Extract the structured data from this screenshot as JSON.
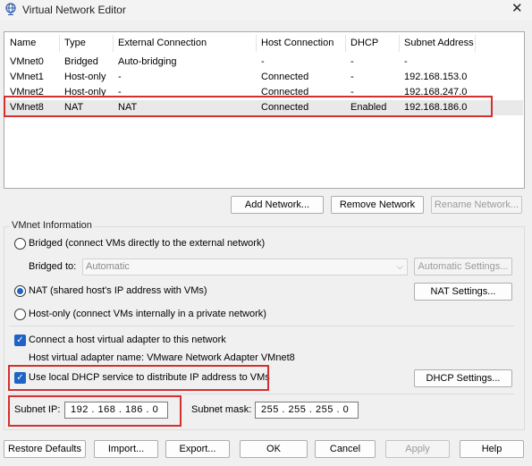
{
  "window": {
    "title": "Virtual Network Editor",
    "close_glyph": "✕",
    "icon": "network-globe-icon"
  },
  "table": {
    "columns": [
      "Name",
      "Type",
      "External Connection",
      "Host Connection",
      "DHCP",
      "Subnet Address"
    ],
    "rows": [
      {
        "name": "VMnet0",
        "type": "Bridged",
        "external": "Auto-bridging",
        "host": "-",
        "dhcp": "-",
        "subnet": "-"
      },
      {
        "name": "VMnet1",
        "type": "Host-only",
        "external": "-",
        "host": "Connected",
        "dhcp": "-",
        "subnet": "192.168.153.0"
      },
      {
        "name": "VMnet2",
        "type": "Host-only",
        "external": "-",
        "host": "Connected",
        "dhcp": "-",
        "subnet": "192.168.247.0"
      },
      {
        "name": "VMnet8",
        "type": "NAT",
        "external": "NAT",
        "host": "Connected",
        "dhcp": "Enabled",
        "subnet": "192.168.186.0"
      }
    ],
    "selected_row": "VMnet8"
  },
  "table_buttons": {
    "add": "Add Network...",
    "remove": "Remove Network",
    "rename": "Rename Network..."
  },
  "vmnet_info": {
    "group_label": "VMnet Information",
    "bridged_label": "Bridged (connect VMs directly to the external network)",
    "bridged_to_label": "Bridged to:",
    "bridged_to_value": "Automatic",
    "auto_settings_button": "Automatic Settings...",
    "nat_label": "NAT (shared host's IP address with VMs)",
    "nat_settings_button": "NAT Settings...",
    "hostonly_label": "Host-only (connect VMs internally in a private network)",
    "connect_adapter_label": "Connect a host virtual adapter to this network",
    "adapter_name_label": "Host virtual adapter name: VMware Network Adapter VMnet8",
    "dhcp_label": "Use local DHCP service to distribute IP address to VMs",
    "dhcp_settings_button": "DHCP Settings...",
    "subnet_ip_label": "Subnet IP:",
    "subnet_ip_value": "192 . 168 . 186 .  0",
    "subnet_mask_label": "Subnet mask:",
    "subnet_mask_value": "255 . 255 . 255 .  0",
    "selected_mode": "NAT",
    "connect_adapter_checked": true,
    "dhcp_checked": true
  },
  "footer": {
    "restore": "Restore Defaults",
    "import": "Import...",
    "export": "Export...",
    "ok": "OK",
    "cancel": "Cancel",
    "apply": "Apply",
    "help": "Help"
  },
  "colors": {
    "highlight": "#d62f2f",
    "accent": "#1f63c6",
    "selected_row": "#e9e9e9"
  }
}
